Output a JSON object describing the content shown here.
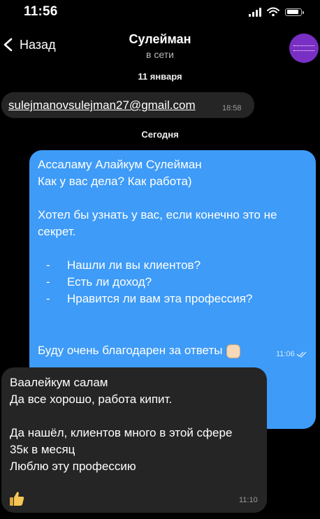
{
  "status_bar": {
    "time": "11:56"
  },
  "header": {
    "back_label": "Назад",
    "contact_name": "Сулейман",
    "contact_status": "в сети"
  },
  "colors": {
    "background": "#000000",
    "incoming_bubble": "#252525",
    "outgoing_bubble": "#3e9bf7",
    "avatar": "#7a2fc4"
  },
  "messages": {
    "date_1": "11 января",
    "email": {
      "text": "sulejmanovsulejman27@gmail.com",
      "time": "18:58"
    },
    "date_2": "Сегодня",
    "outgoing": {
      "lines": [
        "Ассаламу Алайкум Сулейман",
        "Как у вас дела? Как работа)",
        "",
        "Хотел бы узнать у вас, если конечно это не",
        "секрет.",
        ""
      ],
      "list": [
        {
          "dash": "-",
          "text": "Нашли ли вы  клиентов?"
        },
        {
          "dash": "-",
          "text": "Есть ли доход?"
        },
        {
          "dash": "-",
          "text": "Нравится ли вам  эта профессия?"
        }
      ],
      "closing": "Буду очень благодарен за ответы",
      "closing_icon": "raised-fist-emoji",
      "time": "11:06",
      "status_icon": "double-check-icon"
    },
    "incoming": {
      "lines": [
        "Ваалейкум салам",
        "Да все хорошо, работа кипит.",
        "",
        "Да нашёл, клиентов много в этой сфере",
        "35к в месяц",
        "Люблю эту профессию"
      ],
      "emoji_icon": "thumbs-up-emoji",
      "time": "11:10"
    }
  }
}
